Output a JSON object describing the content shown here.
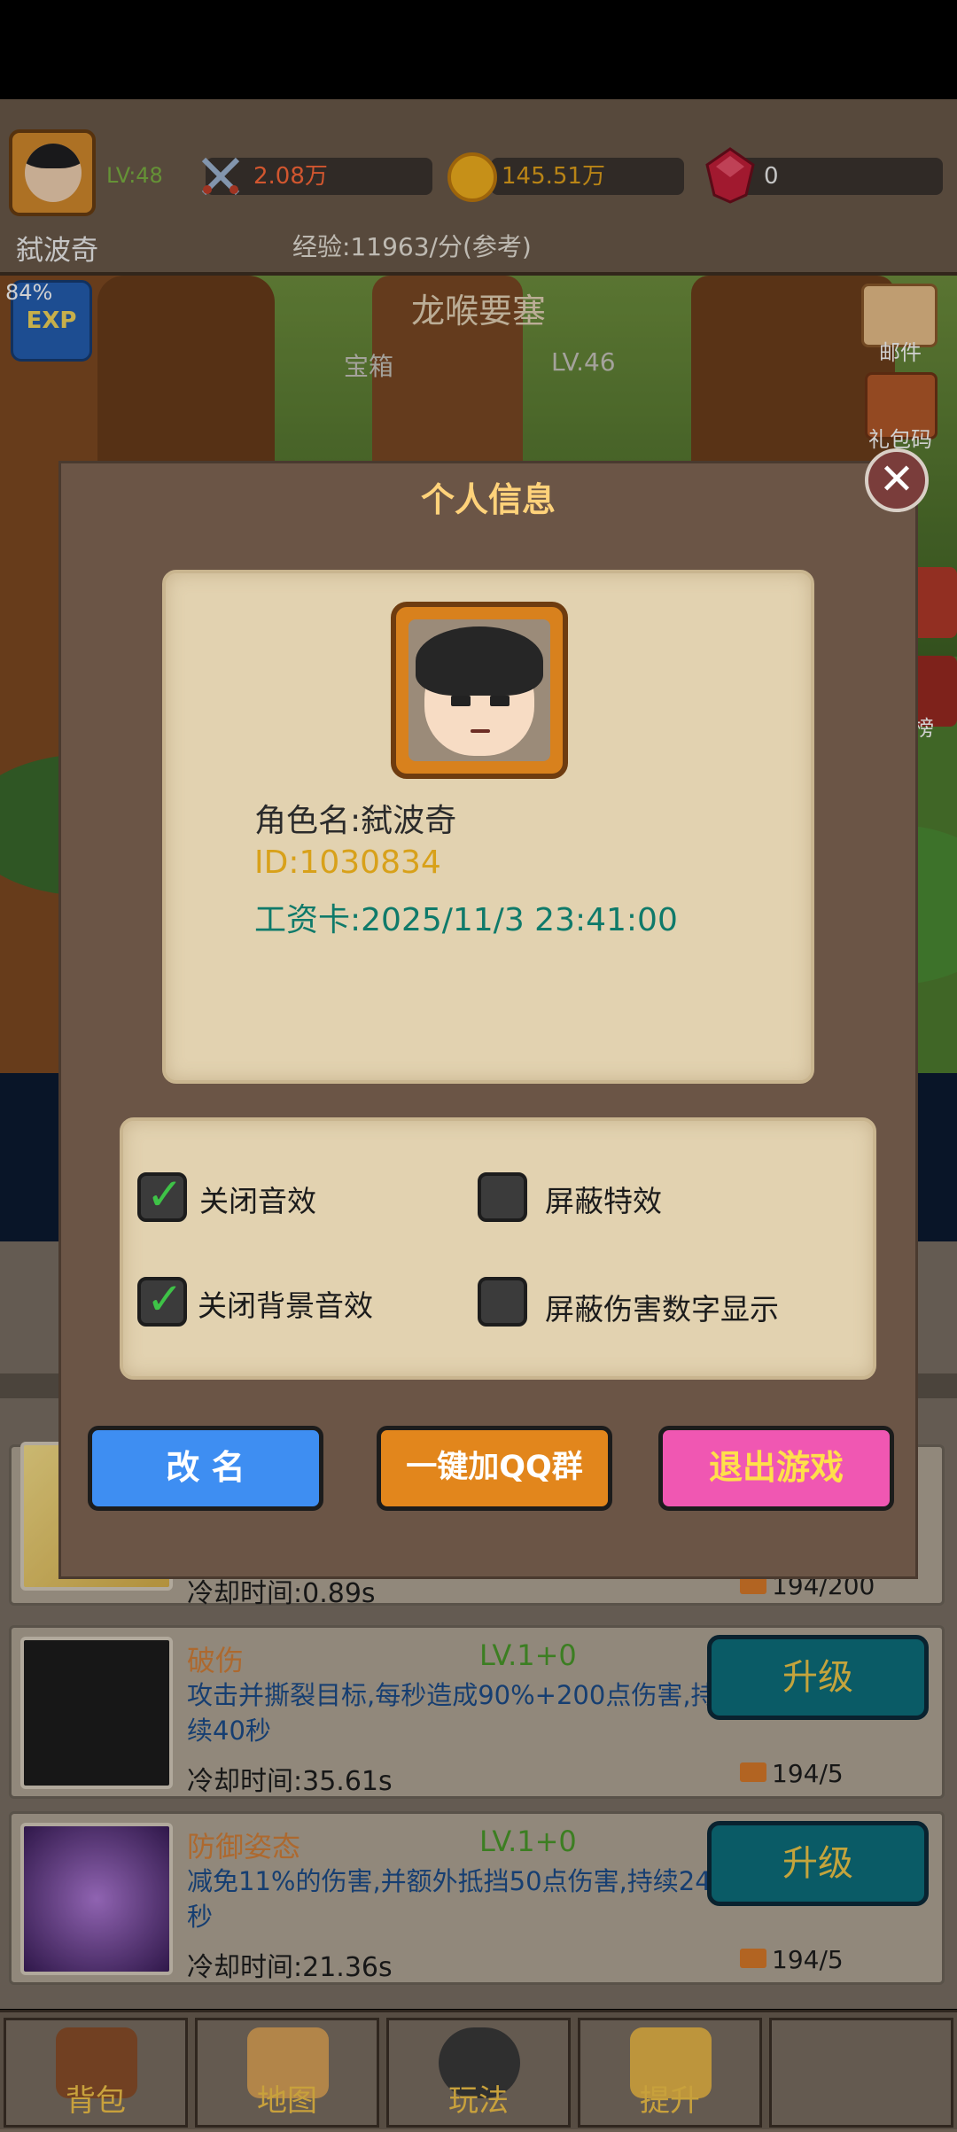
{
  "hud": {
    "level": "LV:48",
    "player_name": "弑波奇",
    "power": "2.08万",
    "gold": "145.51万",
    "gems": "0",
    "exp_rate": "经验:11963/分(参考)"
  },
  "scene": {
    "zone_name": "龙喉要塞",
    "chest_label": "宝箱",
    "zone_level": "LV.46",
    "exp_percent": "84%",
    "exp_badge": "EXP",
    "mail_label": "邮件",
    "gift_label": "礼包码",
    "rank_label": "榜"
  },
  "modal": {
    "title": "个人信息",
    "close": "✕",
    "role_name": "角色名:弑波奇",
    "id": "ID:1030834",
    "pay_card": "工资卡:2025/11/3 23:41:00",
    "options": [
      {
        "label": "关闭音效",
        "checked": true
      },
      {
        "label": "屏蔽特效",
        "checked": false
      },
      {
        "label": "关闭背景音效",
        "checked": true
      },
      {
        "label": "屏蔽伤害数字显示",
        "checked": false
      }
    ],
    "buttons": {
      "rename": "改 名",
      "join_qq": "一键加QQ群",
      "exit": "退出游戏"
    }
  },
  "skills": [
    {
      "cooldown": "冷却时间:0.89s",
      "cost": "194/200"
    },
    {
      "name": "破伤",
      "level": "LV.1+0",
      "desc": "攻击并撕裂目标,每秒造成90%+200点伤害,持续40秒",
      "cooldown": "冷却时间:35.61s",
      "button": "升级",
      "cost": "194/5"
    },
    {
      "name": "防御姿态",
      "level": "LV.1+0",
      "desc": "减免11%的伤害,并额外抵挡50点伤害,持续24秒",
      "cooldown": "冷却时间:21.36s",
      "button": "升级",
      "cost": "194/5"
    }
  ],
  "tabs": [
    {
      "label": "背包",
      "icon": "bag-icon"
    },
    {
      "label": "地图",
      "icon": "map-icon"
    },
    {
      "label": "玩法",
      "icon": "gamepad-icon"
    },
    {
      "label": "提升",
      "icon": "fist-icon"
    }
  ],
  "colors": {
    "modal_bg": "#6b5546",
    "parchment": "#e2d2b0",
    "title_gold": "#ffd27a",
    "upgrade_btn": "#0d6f7d"
  }
}
